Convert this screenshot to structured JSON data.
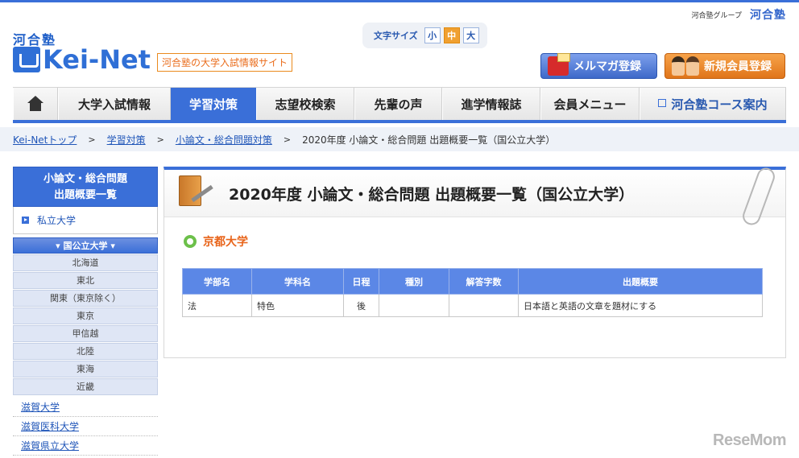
{
  "header": {
    "group_label": "河合塾グループ",
    "group_logo": "河合塾",
    "brand_parent": "河合塾",
    "brand_name": "Kei-Net",
    "tagline": "河合塾の大学入試情報サイト",
    "font_size": {
      "label": "文字サイズ",
      "small": "小",
      "medium": "中",
      "large": "大",
      "selected": "中"
    },
    "mailmag_button": "メルマガ登録",
    "register_button": "新規会員登録"
  },
  "nav": {
    "items": [
      "大学入試情報",
      "学習対策",
      "志望校検索",
      "先輩の声",
      "進学情報誌",
      "会員メニュー"
    ],
    "active": "学習対策",
    "course_link": "河合塾コース案内"
  },
  "breadcrumb": {
    "items": [
      "Kei-Netトップ",
      "学習対策",
      "小論文・総合問題対策"
    ],
    "current": "2020年度 小論文・総合問題 出題概要一覧（国公立大学）",
    "separator": ">"
  },
  "sidebar": {
    "heading_line1": "小論文・総合問題",
    "heading_line2": "出題概要一覧",
    "private_link": "私立大学",
    "national_heading": "▾ 国公立大学 ▾",
    "regions": [
      "北海道",
      "東北",
      "関東（東京除く）",
      "東京",
      "甲信越",
      "北陸",
      "東海",
      "近畿"
    ],
    "universities": [
      "滋賀大学",
      "滋賀医科大学",
      "滋賀県立大学"
    ]
  },
  "main": {
    "title": "2020年度 小論文・総合問題 出題概要一覧（国公立大学）",
    "university": "京都大学",
    "table": {
      "headers": [
        "学部名",
        "学科名",
        "日程",
        "種別",
        "解答字数",
        "出題概要"
      ],
      "rows": [
        [
          "法",
          "特色",
          "後",
          "",
          "",
          "日本語と英語の文章を題材にする"
        ]
      ]
    }
  },
  "watermark": "ReseMom",
  "colors": {
    "accent": "#3a6fd8",
    "university": "#e8641a",
    "ring": "#6cc04a",
    "register": "#e0751a"
  }
}
